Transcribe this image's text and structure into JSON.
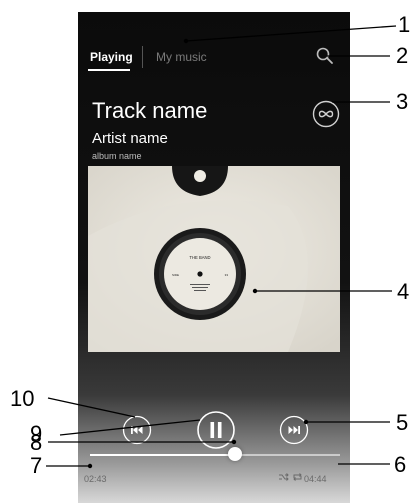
{
  "tabs": [
    {
      "label": "Playing"
    },
    {
      "label": "My music"
    }
  ],
  "track": {
    "title": "Track name",
    "artist": "Artist name",
    "album": "album name"
  },
  "album_art": {
    "label_text": "THE BAND",
    "label_left": "SIDE",
    "label_right": "33"
  },
  "playback": {
    "elapsed": "02:43",
    "total": "04:44",
    "progress_fraction": 0.58
  },
  "icons": {
    "search": "search-icon",
    "infinity": "infinity-icon",
    "previous": "previous-icon",
    "pause": "pause-icon",
    "next": "next-icon",
    "shuffle": "shuffle-icon",
    "repeat": "repeat-icon"
  },
  "callouts": [
    "1",
    "2",
    "3",
    "4",
    "5",
    "6",
    "7",
    "8",
    "9",
    "10"
  ],
  "colors": {
    "text_primary": "#ffffff",
    "text_inactive": "#7a7a7a",
    "label_black": "#000000"
  }
}
